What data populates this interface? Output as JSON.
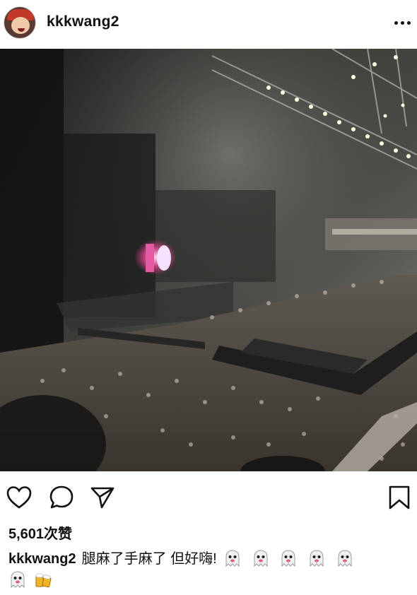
{
  "post": {
    "username": "kkkwang2",
    "likes_text": "5,601次赞",
    "caption_user": "kkkwang2",
    "caption_text": "腿麻了手麻了 但好嗨!",
    "caption_emojis": [
      "ghost",
      "ghost",
      "ghost",
      "ghost",
      "ghost",
      "ghost",
      "beer"
    ]
  },
  "icons": {
    "more": "more-options-icon",
    "like": "heart-icon",
    "comment": "comment-icon",
    "share": "send-icon",
    "save": "bookmark-icon"
  },
  "colors": {
    "text": "#111111",
    "background": "#ffffff",
    "stage_glow": "#c0407f"
  }
}
